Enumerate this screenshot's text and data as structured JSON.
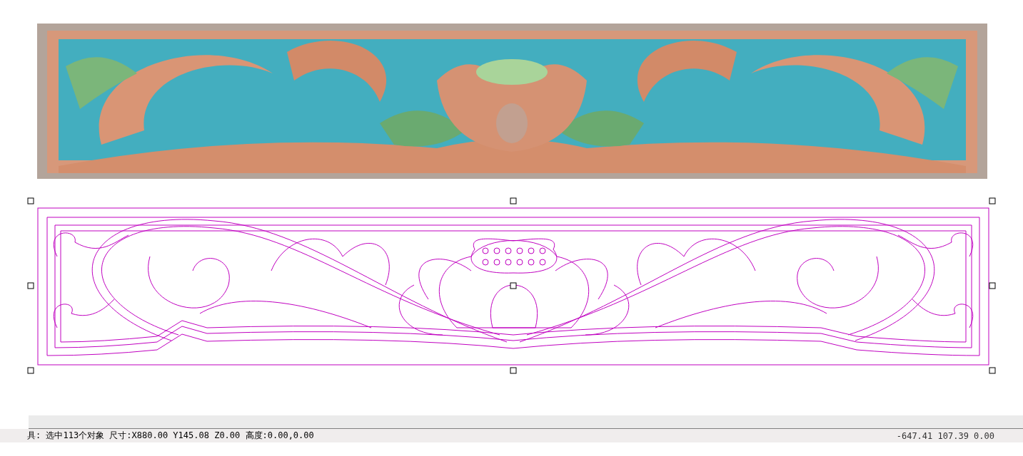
{
  "viewport": {
    "vector_drawing": {
      "selected": true
    }
  },
  "status_bar": {
    "message": "具: 选中113个对象 尺寸:X880.00 Y145.08 Z0.00 高度:0.00,0.00",
    "coordinates": "-647.41 107.39 0.00"
  }
}
